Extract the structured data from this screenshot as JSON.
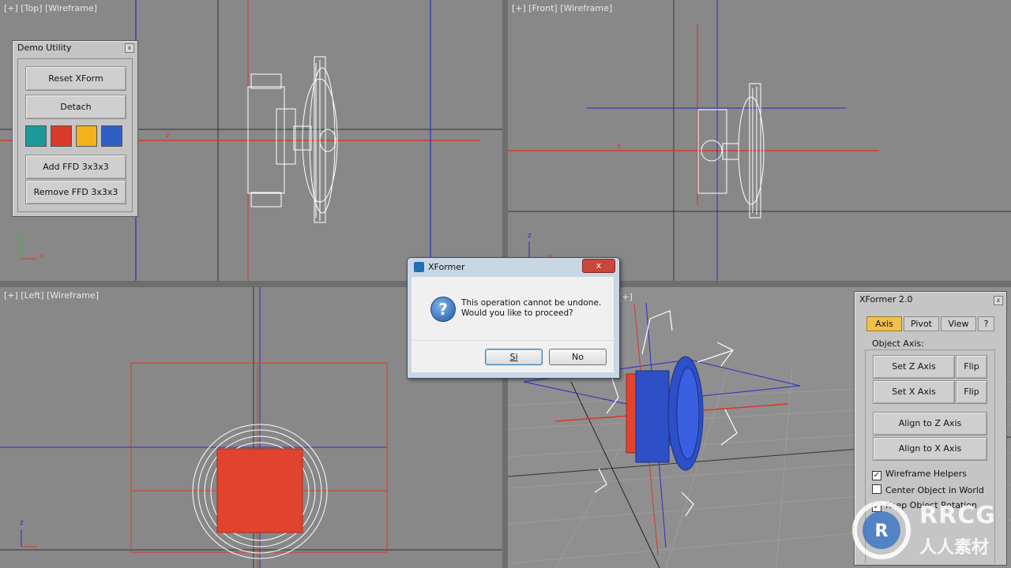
{
  "viewports": {
    "top": {
      "label": "[+] [Top] [Wireframe]"
    },
    "front": {
      "label": "[+] [Front] [Wireframe]"
    },
    "left": {
      "label": "[+] [Left] [Wireframe]"
    },
    "perspective": {
      "label": "[+]"
    }
  },
  "axis_labels": {
    "x": "x",
    "y": "y",
    "z": "z"
  },
  "demo_utility": {
    "title": "Demo Utility",
    "close": "x",
    "buttons": [
      "Reset XForm",
      "Detach",
      "Add FFD 3x3x3",
      "Remove FFD 3x3x3"
    ],
    "swatches": [
      "#1c9999",
      "#d93a2b",
      "#f3b21a",
      "#2f5fc4"
    ]
  },
  "dialog": {
    "title": "XFormer",
    "close": "x",
    "message_line1": "This operation cannot be undone.",
    "message_line2": "Would you like to proceed?",
    "yes": "Si",
    "no": "No"
  },
  "xformer": {
    "title": "XFormer 2.0",
    "close": "x",
    "tabs": [
      "Axis",
      "Pivot",
      "View",
      "?"
    ],
    "active_tab": "Axis",
    "group": "Object Axis:",
    "set_z": "Set Z Axis",
    "set_x": "Set X Axis",
    "flip": "Flip",
    "align_z": "Align to Z Axis",
    "align_x": "Align to X Axis",
    "options": [
      {
        "label": "Wireframe Helpers",
        "checked": true
      },
      {
        "label": "Center Object in World",
        "checked": false
      },
      {
        "label": "Keep Object Rotation",
        "checked": true
      }
    ]
  },
  "watermark": {
    "logo": "RRCG",
    "subtitle": "人人素材"
  },
  "colors": {
    "highlight": "#f0d840",
    "active_tab": "#f2c04a",
    "selection_red": "#e0442e",
    "object_blue": "#2d4fc8"
  }
}
